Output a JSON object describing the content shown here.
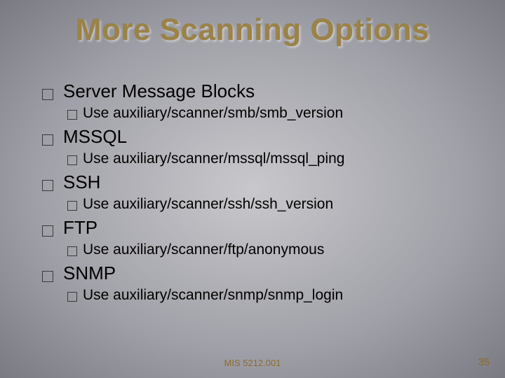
{
  "title": "More Scanning Options",
  "items": [
    {
      "label": "Server Message Blocks",
      "sub": "Use auxiliary/scanner/smb/smb_version"
    },
    {
      "label": "MSSQL",
      "sub": "Use auxiliary/scanner/mssql/mssql_ping"
    },
    {
      "label": "SSH",
      "sub": "Use auxiliary/scanner/ssh/ssh_version"
    },
    {
      "label": "FTP",
      "sub": "Use auxiliary/scanner/ftp/anonymous"
    },
    {
      "label": "SNMP",
      "sub": "Use auxiliary/scanner/snmp/snmp_login"
    }
  ],
  "footer": {
    "courseCode": "MIS 5212.001",
    "slideNumber": "35"
  }
}
